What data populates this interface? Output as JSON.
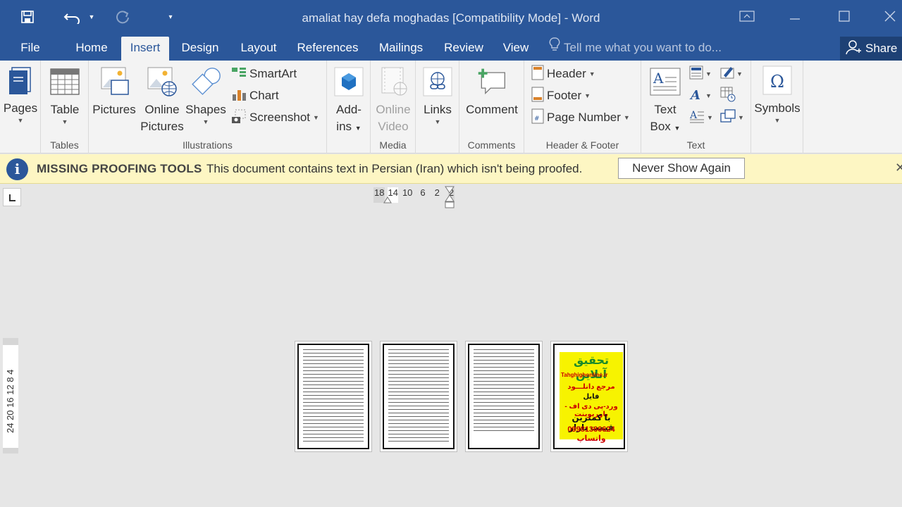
{
  "window": {
    "title": "amaliat hay defa moghadas [Compatibility Mode] - Word",
    "accent": "#2b579a"
  },
  "tabs": [
    {
      "label": "File"
    },
    {
      "label": "Home"
    },
    {
      "label": "Insert",
      "active": true
    },
    {
      "label": "Design"
    },
    {
      "label": "Layout"
    },
    {
      "label": "References"
    },
    {
      "label": "Mailings"
    },
    {
      "label": "Review"
    },
    {
      "label": "View"
    }
  ],
  "tell_me": "Tell me what you want to do...",
  "share": "Share",
  "ribbon": {
    "pages": {
      "label": "Pages"
    },
    "tables": {
      "table": "Table",
      "group": "Tables"
    },
    "illustrations": {
      "pictures": "Pictures",
      "online_pictures_1": "Online",
      "online_pictures_2": "Pictures",
      "shapes": "Shapes",
      "smartart": "SmartArt",
      "chart": "Chart",
      "screenshot": "Screenshot",
      "group": "Illustrations"
    },
    "addins": {
      "label_1": "Add-",
      "label_2": "ins"
    },
    "media": {
      "label_1": "Online",
      "label_2": "Video",
      "group": "Media"
    },
    "links": {
      "label": "Links"
    },
    "comments": {
      "comment": "Comment",
      "group": "Comments"
    },
    "header_footer": {
      "header": "Header",
      "footer": "Footer",
      "page_number": "Page Number",
      "group": "Header & Footer"
    },
    "text": {
      "textbox_1": "Text",
      "textbox_2": "Box",
      "group": "Text"
    },
    "symbols": {
      "label": "Symbols"
    }
  },
  "message_bar": {
    "title": "MISSING PROOFING TOOLS",
    "text": "This document contains text in Persian (Iran) which isn't being proofed.",
    "button": "Never Show Again"
  },
  "ruler": {
    "horizontal": [
      "18",
      "14",
      "10",
      "6",
      "2",
      "2"
    ],
    "vertical": "24 20 16 12  8   4"
  },
  "ad_page": {
    "title": "تحقیق آنلاین",
    "site": "Tahghighonline.ir",
    "line1": "مرجع دانلـــود",
    "line2": "فایل",
    "line3": "ورد-پی دی اف - پاورپوینت",
    "line4": "با کمترین قیمت بازار",
    "phone": "09981366624 واتساپ"
  }
}
